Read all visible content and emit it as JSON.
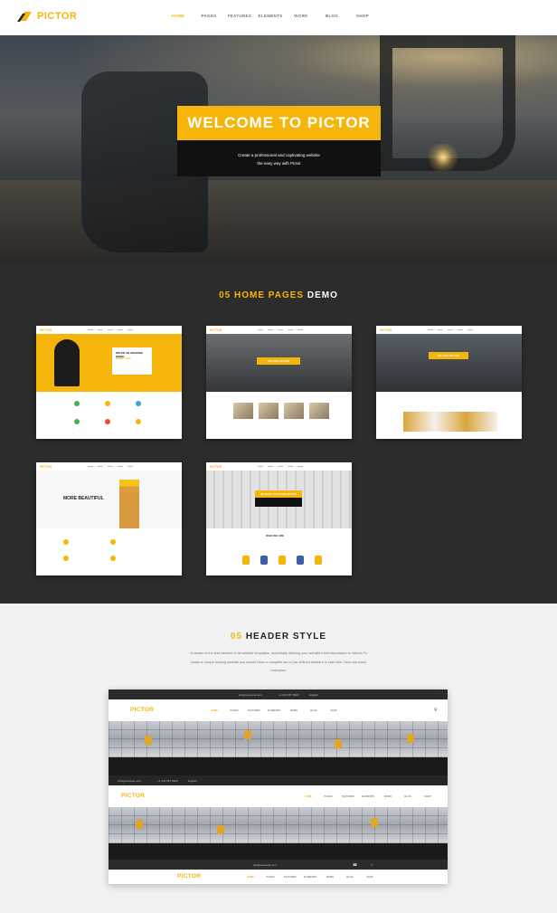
{
  "brand": {
    "name": "PICTOR",
    "accent": "#f5b50a"
  },
  "nav": {
    "items": [
      "HOME",
      "PAGES",
      "FEATURES",
      "ELEMENTS",
      "WORK",
      "BLOG",
      "SHOP"
    ],
    "active": "HOME"
  },
  "hero": {
    "title": "WELCOME TO PICTOR",
    "subtitle_line1": "Create a professional and captivating website",
    "subtitle_line2": "the easy way with Pictor"
  },
  "demos": {
    "title_highlight": "05 HOME PAGES",
    "title_rest": " DEMO",
    "thumbs": [
      {
        "logo": "PICTOR",
        "banner_text": "WE DO AN AMAZING WORK",
        "banner_sub": "EVERY DAY"
      },
      {
        "logo": "PICTOR",
        "banner_text": "WE ARE PICTOR"
      },
      {
        "logo": "PICTOR",
        "banner_text": "WE ARE PICTOR"
      },
      {
        "logo": "PICTOR",
        "banner_text": "MORE BEAUTIFUL"
      },
      {
        "logo": "PICTOR",
        "banner_text": "WE MAKE YOUR HOME BETTER",
        "body_heading": "WHO WE ARE"
      }
    ]
  },
  "header_style": {
    "title_highlight": "05",
    "title_rest": " HEADER STYLE",
    "description": "A header is the first element of all website templates, essentially defining your website's first impression to visitors.To create a unique looking website you should have a complete set of pre-defined headers to start with. Here are some examples:",
    "topbar_email": "info@example.com",
    "topbar_phone": "+1 234 567 8900",
    "topbar_lang": "English",
    "menu": [
      "HOME",
      "PAGES",
      "FEATURES",
      "ELEMENTS",
      "WORK",
      "BLOG",
      "SHOP"
    ]
  }
}
